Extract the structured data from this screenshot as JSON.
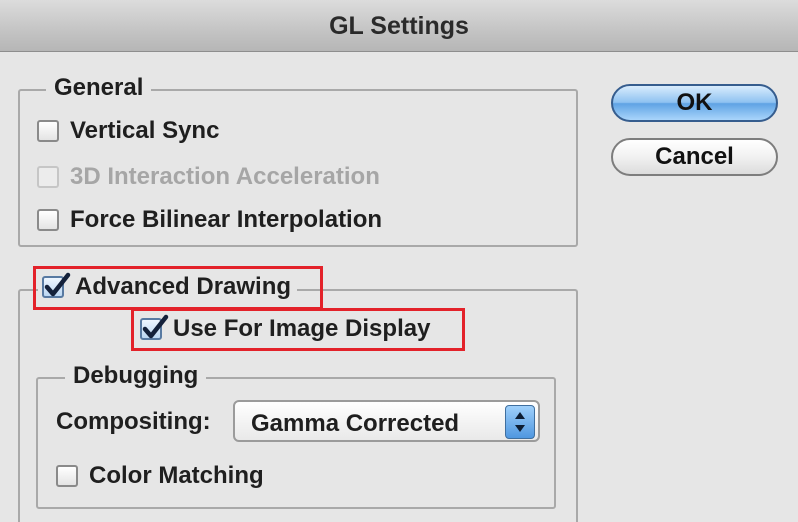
{
  "window": {
    "title": "GL Settings"
  },
  "general": {
    "legend": "General",
    "vertical_sync": {
      "label": "Vertical Sync",
      "checked": false,
      "enabled": true
    },
    "interaction_acceleration": {
      "label": "3D Interaction Acceleration",
      "checked": false,
      "enabled": false
    },
    "force_bilinear": {
      "label": "Force Bilinear Interpolation",
      "checked": false,
      "enabled": true
    }
  },
  "advanced": {
    "advanced_drawing": {
      "label": "Advanced Drawing",
      "checked": true
    },
    "use_for_image_display": {
      "label": "Use For Image Display",
      "checked": true
    }
  },
  "debugging": {
    "legend": "Debugging",
    "compositing_label": "Compositing:",
    "compositing_value": "Gamma Corrected",
    "color_matching": {
      "label": "Color Matching",
      "checked": false
    }
  },
  "buttons": {
    "ok": "OK",
    "cancel": "Cancel"
  },
  "colors": {
    "highlight": "#e3222a",
    "default_button": "#5fa3e4"
  }
}
